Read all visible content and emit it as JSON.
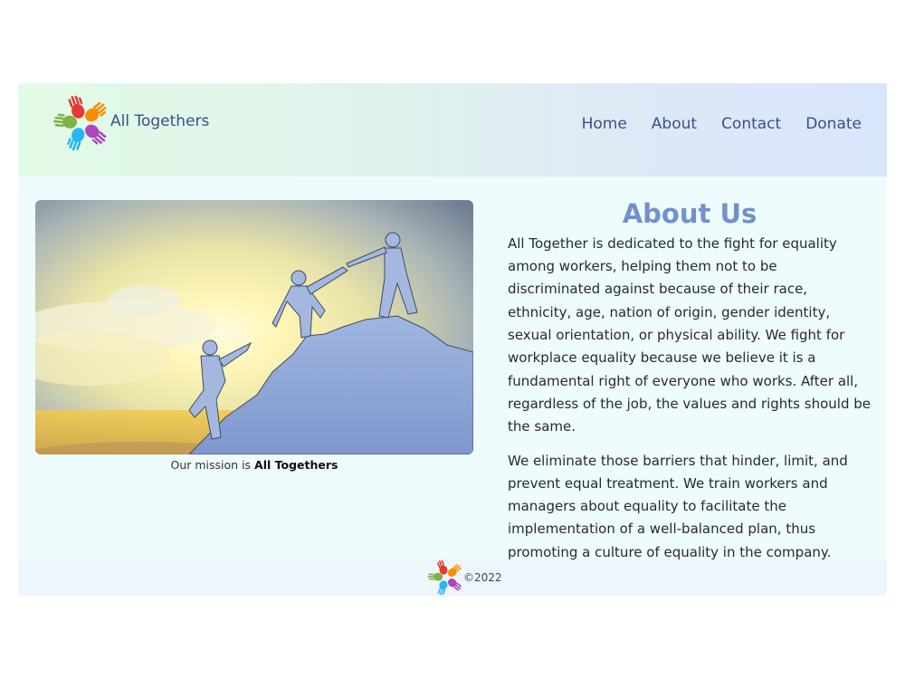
{
  "header": {
    "brand_name": "All Togethers",
    "nav": [
      "Home",
      "About",
      "Contact",
      "Donate"
    ]
  },
  "hero": {
    "caption_prefix": "Our mission is",
    "caption_bold": "All Togethers"
  },
  "about": {
    "title": "About Us",
    "paragraphs": [
      "All Together is dedicated to the fight for equality among workers, helping them not to be discriminated against because of their race, ethnicity, age, nation of origin, gender identity, sexual orientation, or physical ability. We fight for workplace equality because we believe it is a fundamental right of everyone who works. After all, regardless of the job, the values and rights should be the same.",
      "We eliminate those barriers that hinder, limit, and prevent equal treatment. We train workers and managers about equality to facilitate the implementation of a well-balanced plan, thus promoting a culture of equality in the company."
    ]
  },
  "footer": {
    "copyright": "©2022"
  },
  "colors": {
    "accent": "#7290cc",
    "nav_text": "#3b4f8a",
    "page_bg": "#eefcfd"
  }
}
